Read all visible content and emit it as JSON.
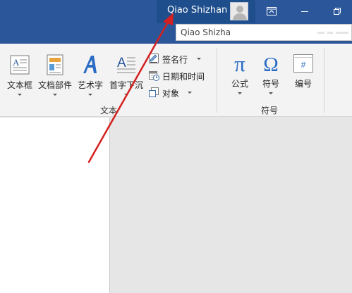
{
  "titlebar": {
    "account_name": "Qiao Shizhan",
    "buttons": {
      "ribbon_options": "ribbon-display-options-icon",
      "minimize": "minimize-icon",
      "restore": "restore-icon"
    },
    "colors": {
      "bar": "#2b579a",
      "account_highlight": "#1e4e8c"
    }
  },
  "account_popup": {
    "text": "Qiao Shizha"
  },
  "ribbon": {
    "text_group": {
      "label": "文本",
      "buttons": [
        {
          "label": "文本框",
          "icon": "textbox-icon"
        },
        {
          "label": "文档部件",
          "icon": "quick-parts-icon"
        },
        {
          "label": "艺术字",
          "icon": "wordart-icon"
        },
        {
          "label": "首字下沉",
          "icon": "drop-cap-icon"
        }
      ],
      "small_buttons": [
        {
          "label": "签名行",
          "icon": "signature-line-icon"
        },
        {
          "label": "日期和时间",
          "icon": "date-time-icon"
        },
        {
          "label": "对象",
          "icon": "object-icon"
        }
      ]
    },
    "symbols_group": {
      "label": "符号",
      "buttons": [
        {
          "label": "公式",
          "icon": "pi-icon",
          "glyph": "π"
        },
        {
          "label": "符号",
          "icon": "omega-icon",
          "glyph": "Ω"
        },
        {
          "label": "编号",
          "icon": "hash-icon",
          "glyph": "#"
        }
      ]
    }
  },
  "annotation": {
    "color": "#d42020"
  }
}
